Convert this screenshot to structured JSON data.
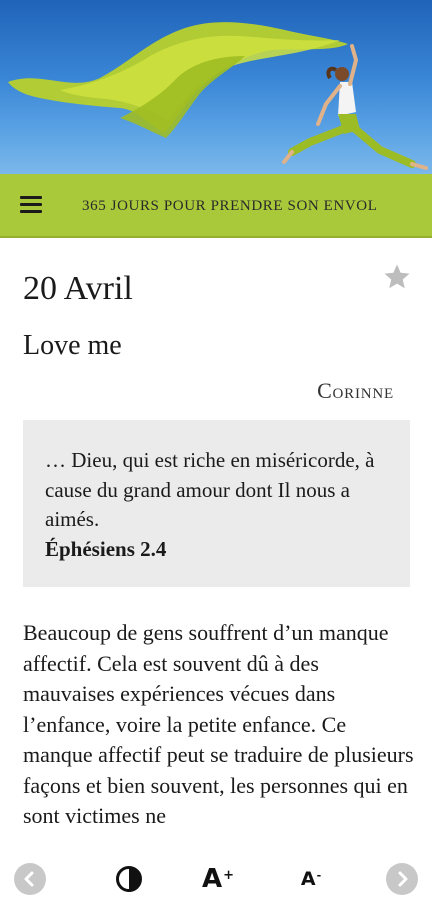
{
  "header": {
    "title": "365 JOURS POUR PRENDRE SON ENVOL",
    "menu_icon": "hamburger-icon",
    "banner": "woman-leaping-with-green-scarf-image"
  },
  "entry": {
    "date": "20 Avril",
    "title": "Love me",
    "author": "Corinne",
    "favorite_icon": "star-icon",
    "quote": {
      "text": "… Dieu, qui est riche en miséricorde, à cause du grand amour dont Il nous a aimés.",
      "reference": "Éphésiens 2.4"
    },
    "body": "Beaucoup de gens souffrent d’un manque affectif. Cela est souvent dû à des mauvaises expériences vécues dans l’enfance, voire la petite enfance. Ce manque affectif peut se traduire de plusieurs façons et bien souvent, les personnes qui en sont victimes ne"
  },
  "toolbar": {
    "prev_icon": "chevron-left-icon",
    "contrast_icon": "contrast-icon",
    "font_increase_label": "A",
    "font_increase_sign": "+",
    "font_decrease_label": "A",
    "font_decrease_sign": "-",
    "next_icon": "chevron-right-icon"
  },
  "colors": {
    "accent_green": "#a9c93a",
    "quote_background": "#ebebeb",
    "sky_blue": "#2f78cc"
  }
}
